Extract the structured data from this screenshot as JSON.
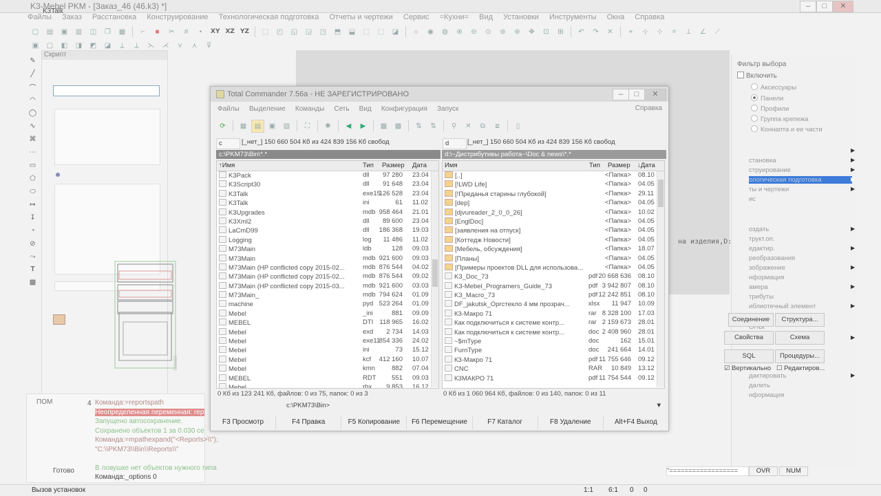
{
  "k3": {
    "title": "K3-Mebel PKM - [Заказ_46 (46.k3) *]",
    "overlay_title": "K3Talk",
    "menu": [
      "Файлы",
      "Заказ",
      "Расстановка",
      "Конструирование",
      "Технологическая подготовка",
      "Отчеты и чертежи",
      "Сервис",
      "=Кухни=",
      "Вид",
      "Установки",
      "Инструменты",
      "Окна",
      "Справка"
    ],
    "toolbar_labels": [
      "XY",
      "XZ",
      "YZ"
    ],
    "script_panel_title": "Скрипт",
    "console_num": "4",
    "console_label": "ПОМ",
    "console_lines": [
      {
        "text": "Команда:=reportspath",
        "color": "#b58a8a",
        "bg": ""
      },
      {
        "text": "Неопределенная переменная: rep",
        "color": "#ffffff",
        "bg": "#e08c8c"
      },
      {
        "text": "Запущено автосохранение.",
        "color": "#8cc08c",
        "bg": ""
      },
      {
        "text": "Сохранено объектов 1 за 0.030 се",
        "color": "#8cc08c",
        "bg": ""
      },
      {
        "text": "Команда:=mpathexpand(\"<Reports>\\\\\");",
        "color": "#b58a8a",
        "bg": ""
      },
      {
        "text": "\"C:\\\\PKM73\\\\Bin\\\\Reports\\\\\"",
        "color": "#b58a8a",
        "bg": ""
      },
      {
        "text": "",
        "color": "#b58a8a",
        "bg": ""
      },
      {
        "text": "В ловушке нет объектов нужного типа",
        "color": "#8cc08c",
        "bg": ""
      },
      {
        "text": "Команда:_options 0",
        "color": "#444444",
        "bg": ""
      }
    ],
    "ready": "Готово",
    "status_left": "Вызов установок",
    "status_cells": [
      "1:1",
      "6:1",
      "0",
      "0"
    ],
    "indicators": [
      "OVR",
      "NUM"
    ],
    "cmd_line_text": "\"=================="
  },
  "right_panel": {
    "filter_title": "Фильтр выбора",
    "enable": "Включить",
    "radios": [
      "Аксессуары",
      "Панели",
      "Профили",
      "Группа крепежа",
      "Коннапта и ее части"
    ],
    "selected_radio": 1,
    "menu_items": [
      "становка",
      "струирование",
      "ологическая подготовка",
      "ты и чертежи",
      "ис"
    ],
    "menu_items2": [
      "оздать",
      "трукт.оп.",
      "едактир.",
      "реобразования",
      "зображение",
      "нформация",
      "амера",
      "трибуты",
      "иблиотечный элемент",
      "ОНЫ",
      "дактировать",
      "далить",
      "нформация"
    ],
    "extra_text": "на изделия,D:",
    "buttons": {
      "connect": "Соединение",
      "structure": "Структура...",
      "props": "Свойства",
      "scheme": "Схема",
      "sql": "SQL",
      "procs": "Процедуры...",
      "vertical": "Вертикально",
      "edit": "Редактиров..."
    }
  },
  "tc": {
    "title": "Total Commander 7.56a - НЕ ЗАРЕГИСТРИРОВАНО",
    "menu": [
      "Файлы",
      "Выделение",
      "Команды",
      "Сеть",
      "Вид",
      "Конфигурация",
      "Запуск"
    ],
    "help": "Справка",
    "left_drive": "c",
    "left_drive_info": "[_нет_]  150 660 504 Кб из 424 839 156 Кб свобод",
    "right_drive": "d",
    "right_drive_info": "[_нет_]  150 660 504 Кб из 424 839 156 Кб свобод",
    "left_path": "c:\\PKM73\\Bin\\*.*",
    "right_path": "d:\\~Дистрибутивы работа~\\Doc & news\\*.*",
    "headers": {
      "name": "↑Имя",
      "type": "Тип",
      "size": "Размер",
      "date": "Дата"
    },
    "right_headers": {
      "name": "Имя",
      "type": "Тип",
      "size": "Размер",
      "date": "↓Дата"
    },
    "left_files": [
      [
        "K3Pack",
        "dll",
        "97 280",
        "23.04"
      ],
      [
        "K3Script30",
        "dll",
        "91 648",
        "23.04"
      ],
      [
        "K3Talk",
        "exe15",
        "126 528",
        "23.04"
      ],
      [
        "K3Talk",
        "ini",
        "61",
        "11.02"
      ],
      [
        "K3Upgrades",
        "mdb",
        "958 464",
        "21.01"
      ],
      [
        "K3Xml2",
        "dll",
        "89 600",
        "23.04"
      ],
      [
        "LaCmD99",
        "dll",
        "186 368",
        "19.03"
      ],
      [
        "Logging",
        "log",
        "11 486",
        "11.02"
      ],
      [
        "M73Main",
        "ldb",
        "128",
        "09.03"
      ],
      [
        "M73Main",
        "mdb",
        "921 600",
        "09.03"
      ],
      [
        "M73Main (HP conflicted copy 2015-02...",
        "mdb",
        "876 544",
        "04.02"
      ],
      [
        "M73Main (HP conflicted copy 2015-02...",
        "mdb",
        "876 544",
        "09.02"
      ],
      [
        "M73Main (HP conflicted copy 2015-03...",
        "mdb",
        "921 600",
        "03.03"
      ],
      [
        "M73Main_",
        "mdb",
        "794 624",
        "01.09"
      ],
      [
        "machine",
        "pyd",
        "523 264",
        "01.09"
      ],
      [
        "Mebel",
        "_ini",
        "881",
        "09.09"
      ],
      [
        "MEBEL",
        "DTI",
        "118 965",
        "16.02"
      ],
      [
        "Mebel",
        "exd",
        "2 734",
        "14.03"
      ],
      [
        "Mebel",
        "exe11",
        "854 336",
        "24.02"
      ],
      [
        "Mebel",
        "ini",
        "73",
        "15.12"
      ],
      [
        "Mebel",
        "kcf",
        "412 160",
        "10.07"
      ],
      [
        "Mebel",
        "kmn",
        "882",
        "07.04"
      ],
      [
        "MEBEL",
        "RDT",
        "551",
        "09.03"
      ],
      [
        "Mebel",
        "rbx",
        "9 853",
        "16.12"
      ]
    ],
    "right_files": [
      [
        "[..]",
        "",
        "<Папка>",
        "08.10",
        1
      ],
      [
        "[!LWD Life]",
        "",
        "<Папка>",
        "04.05",
        1
      ],
      [
        "[!Преданья старины глубокой]",
        "",
        "<Папка>",
        "29.11",
        1
      ],
      [
        "[dep]",
        "",
        "<Папка>",
        "04.05",
        1
      ],
      [
        "[djvureader_2_0_0_26]",
        "",
        "<Папка>",
        "10.02",
        1
      ],
      [
        "[EnglDoc]",
        "",
        "<Папка>",
        "04.05",
        1
      ],
      [
        "[заявления на отпуск]",
        "",
        "<Папка>",
        "04.05",
        1
      ],
      [
        "[Коттедж Новости]",
        "",
        "<Папка>",
        "04.05",
        1
      ],
      [
        "[Мебель, обсуждения]",
        "",
        "<Папка>",
        "18.07",
        1
      ],
      [
        "[Планы]",
        "",
        "<Папка>",
        "04.05",
        1
      ],
      [
        "[Примеры проектов DLL для использова...",
        "",
        "<Папка>",
        "04.05",
        1
      ],
      [
        "K3_Doc_73",
        "pdf",
        "20 668 636",
        "08.10",
        0
      ],
      [
        "K3-Mebel_Programers_Guide_73",
        "pdf",
        "3 942 807",
        "08.10",
        0
      ],
      [
        "K3_Macro_73",
        "pdf",
        "12 242 851",
        "08.10",
        0
      ],
      [
        "DF_jakutsk_Оргстекло 4 мм прозрач...",
        "xlsx",
        "11 947",
        "10.09",
        0
      ],
      [
        "К3-Макро 71",
        "rar",
        "8 328 100",
        "17.03",
        0
      ],
      [
        "Как подключиться к системе контр...",
        "rar",
        "2 159 673",
        "28.01",
        0
      ],
      [
        "Как подключиться к системе контр...",
        "doc",
        "2 408 960",
        "28.01",
        0
      ],
      [
        "~$mType",
        "doc",
        "162",
        "15.01",
        0
      ],
      [
        "FurnType",
        "doc",
        "241 664",
        "14.01",
        0
      ],
      [
        "К3-Макро 71",
        "pdf",
        "11 755 646",
        "09.12",
        0
      ],
      [
        "CNC",
        "RAR",
        "10 849",
        "13.12",
        0
      ],
      [
        "К3МАКРО 71",
        "pdf",
        "11 754 544",
        "09.12",
        0
      ]
    ],
    "left_status": "0 Кб из 123 241 Кб, файлов: 0 из 75, папок: 0 из 3",
    "right_status": "0 Кб из 1 060 964 Кб, файлов: 0 из 140, папок: 0 из 11",
    "cmd_path": "c:\\PKM73\\Bin>",
    "fkeys": [
      "F3 Просмотр",
      "F4 Правка",
      "F5 Копирование",
      "F6 Перемещение",
      "F7 Каталог",
      "F8 Удаление",
      "Alt+F4 Выход"
    ]
  }
}
